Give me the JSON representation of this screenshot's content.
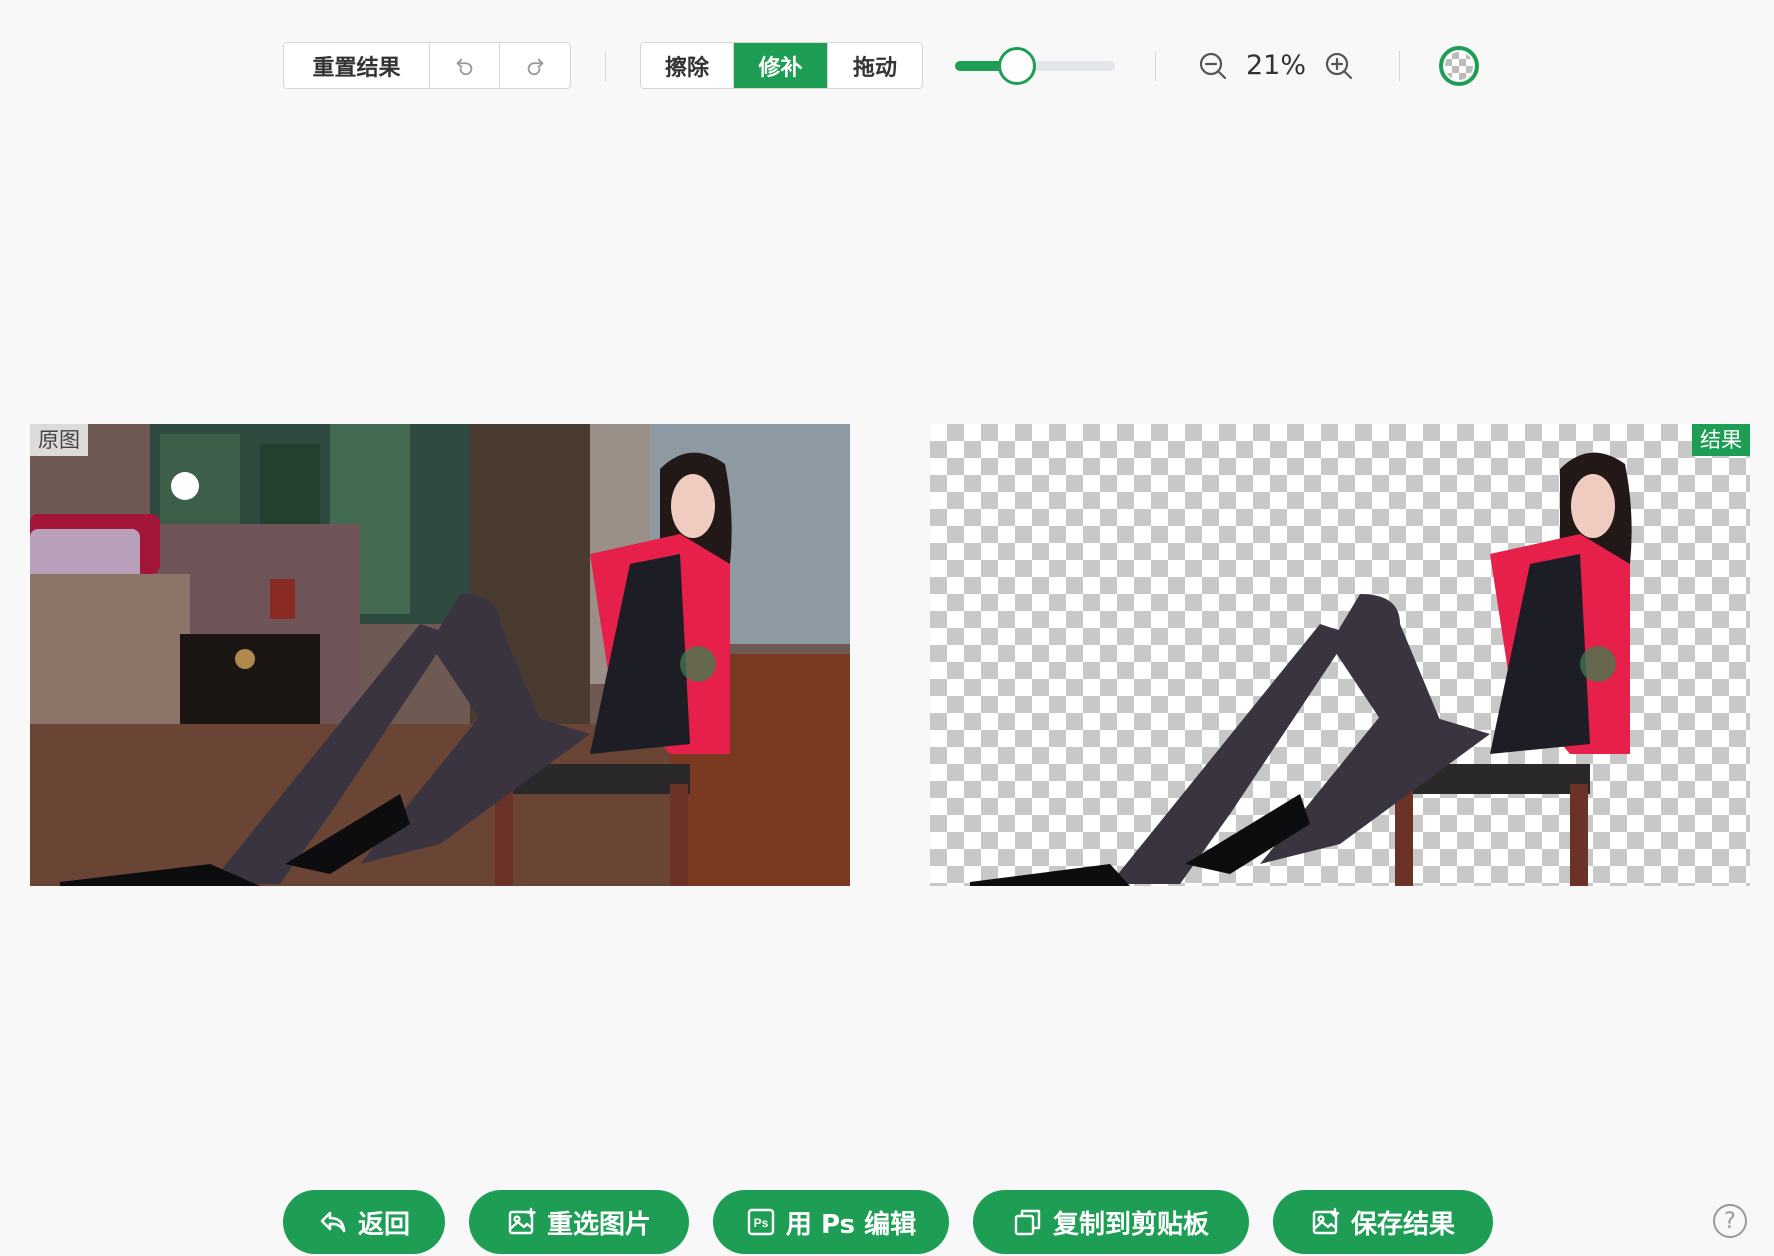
{
  "toolbar": {
    "reset_label": "重置结果",
    "undo_icon": "undo-icon",
    "redo_icon": "redo-icon",
    "modes": [
      {
        "label": "擦除",
        "active": false
      },
      {
        "label": "修补",
        "active": true
      },
      {
        "label": "拖动",
        "active": false
      }
    ],
    "brush_size_fraction": 0.39,
    "zoom_out_icon": "zoom-out-icon",
    "zoom_level": "21%",
    "zoom_in_icon": "zoom-in-icon",
    "background_toggle_icon": "transparent-bg-icon"
  },
  "panels": {
    "original_label": "原图",
    "result_label": "结果"
  },
  "actions": [
    {
      "label": "返回",
      "icon": "back-icon"
    },
    {
      "label": "重选图片",
      "icon": "image-icon"
    },
    {
      "label": "用 Ps 编辑",
      "icon": "ps-icon"
    },
    {
      "label": "复制到剪贴板",
      "icon": "copy-icon"
    },
    {
      "label": "保存结果",
      "icon": "save-image-icon"
    }
  ],
  "help_icon": "help-icon",
  "colors": {
    "accent": "#1e9e55",
    "background": "#f8f8f8"
  }
}
